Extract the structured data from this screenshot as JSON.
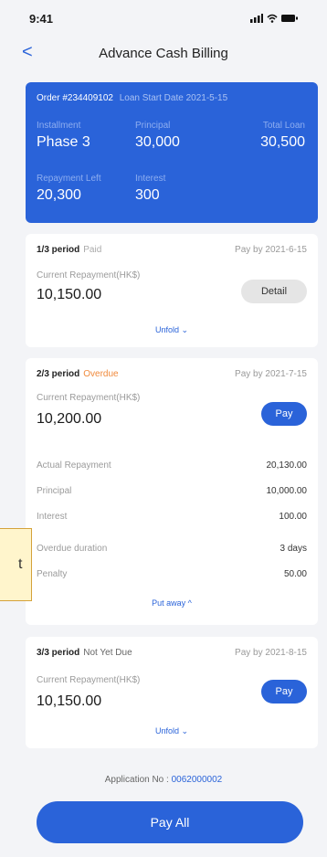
{
  "status": {
    "time": "9:41"
  },
  "header": {
    "back": "<",
    "title": "Advance Cash Billing"
  },
  "summary": {
    "order": "Order #234409102",
    "start_date": "Loan Start Date 2021-5-15",
    "installment_label": "Installment",
    "installment": "Phase 3",
    "principal_label": "Principal",
    "principal": "30,000",
    "total_label": "Total Loan",
    "total": "30,500",
    "left_label": "Repayment Left",
    "left": "20,300",
    "interest_label": "Interest",
    "interest": "300"
  },
  "periods": [
    {
      "period": "1/3 period",
      "status": "Paid",
      "pay_by": "Pay by 2021-6-15",
      "current_label": "Current Repayment(HK$)",
      "amount": "10,150.00",
      "button": "Detail",
      "toggle": "Unfold ⌄"
    },
    {
      "period": "2/3 period",
      "status": "Overdue",
      "pay_by": "Pay by 2021-7-15",
      "current_label": "Current Repayment(HK$)",
      "amount": "10,200.00",
      "button": "Pay",
      "details": [
        {
          "label": "Actual Repayment",
          "value": "20,130.00"
        },
        {
          "label": "Principal",
          "value": "10,000.00"
        },
        {
          "label": "Interest",
          "value": "100.00"
        },
        {
          "label": "Overdue duration",
          "value": "3 days"
        },
        {
          "label": "Penalty",
          "value": "50.00"
        }
      ],
      "toggle": "Put away ^"
    },
    {
      "period": "3/3 period",
      "status": "Not Yet Due",
      "pay_by": "Pay by 2021-8-15",
      "current_label": "Current Repayment(HK$)",
      "amount": "10,150.00",
      "button": "Pay",
      "toggle": "Unfold ⌄"
    }
  ],
  "application": {
    "label": "Application No :",
    "number": "0062000002"
  },
  "pay_all": "Pay All",
  "callout": {
    "text": "t"
  },
  "colors": {
    "accent": "#2a63d9",
    "overdue": "#f08a3c"
  }
}
